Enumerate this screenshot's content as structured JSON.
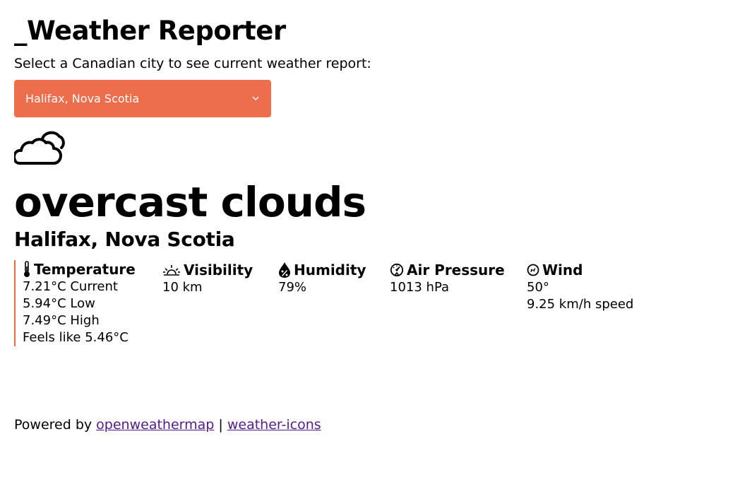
{
  "app": {
    "title": "_Weather Reporter"
  },
  "prompt": "Select a Canadian city to see current weather report:",
  "city_select": {
    "value": "Halifax, Nova Scotia",
    "color": "#ec6e4c",
    "icon": "chevron-down-icon"
  },
  "weather": {
    "icon": "cloudy-icon",
    "condition": "overcast clouds",
    "city": "Halifax, Nova Scotia"
  },
  "stats": {
    "temperature": {
      "label": "Temperature",
      "icon": "thermometer-icon",
      "current": "7.21°C Current",
      "low": "5.94°C Low",
      "high": "7.49°C High",
      "feels_like": "Feels like 5.46°C"
    },
    "visibility": {
      "label": "Visibility",
      "icon": "sunrise-icon",
      "value": "10 km"
    },
    "humidity": {
      "label": "Humidity",
      "icon": "humidity-icon",
      "value": "79%"
    },
    "pressure": {
      "label": "Air Pressure",
      "icon": "barometer-icon",
      "value": "1013 hPa"
    },
    "wind": {
      "label": "Wind",
      "icon": "wind-direction-icon",
      "direction": "50°",
      "speed": "9.25 km/h speed"
    }
  },
  "footer": {
    "powered_by": "Powered by",
    "link1": "openweathermap",
    "separator": "|",
    "link2": "weather-icons"
  }
}
